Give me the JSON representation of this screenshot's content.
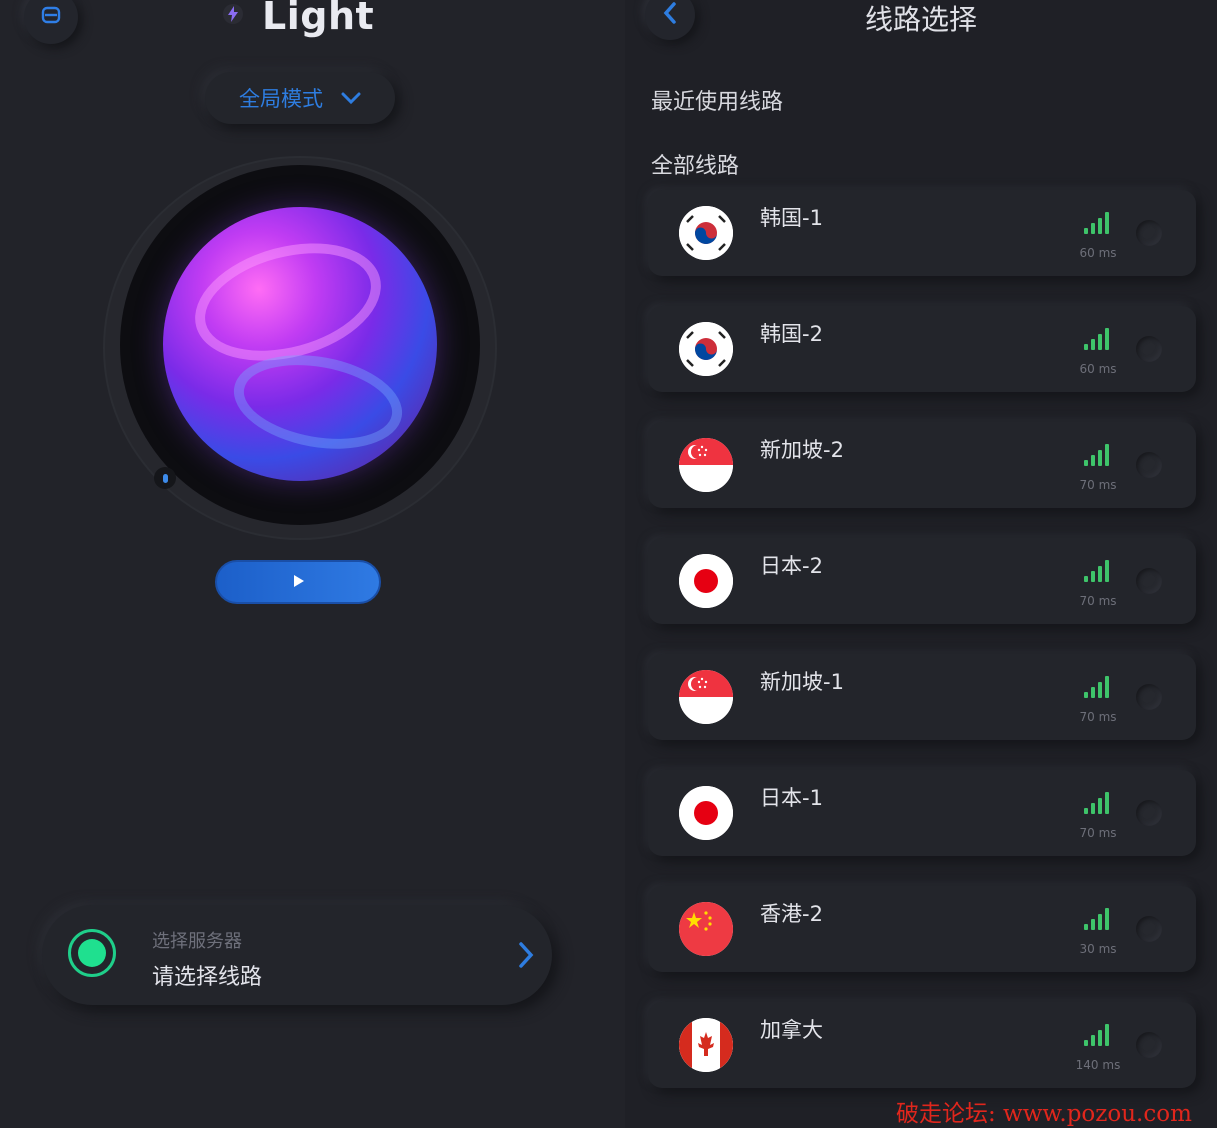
{
  "app": {
    "name": "Light"
  },
  "left": {
    "mode_label": "全局模式",
    "server_card": {
      "label": "选择服务器",
      "value": "请选择线路"
    }
  },
  "right": {
    "title": "线路选择",
    "recent_header": "最近使用线路",
    "all_header": "全部线路",
    "routes": [
      {
        "name": "韩国-1",
        "latency": "60 ms",
        "flag": "korea"
      },
      {
        "name": "韩国-2",
        "latency": "60 ms",
        "flag": "korea"
      },
      {
        "name": "新加坡-2",
        "latency": "70 ms",
        "flag": "singapore"
      },
      {
        "name": "日本-2",
        "latency": "70 ms",
        "flag": "japan"
      },
      {
        "name": "新加坡-1",
        "latency": "70 ms",
        "flag": "singapore"
      },
      {
        "name": "日本-1",
        "latency": "70 ms",
        "flag": "japan"
      },
      {
        "name": "香港-2",
        "latency": "30 ms",
        "flag": "china"
      },
      {
        "name": "加拿大",
        "latency": "140 ms",
        "flag": "canada"
      }
    ]
  },
  "watermark": "破走论坛: www.pozou.com",
  "colors": {
    "accent_blue": "#2e7de0",
    "status_green": "#1fe08f",
    "signal_green": "#3ec46a",
    "watermark_red": "#e0261c"
  }
}
